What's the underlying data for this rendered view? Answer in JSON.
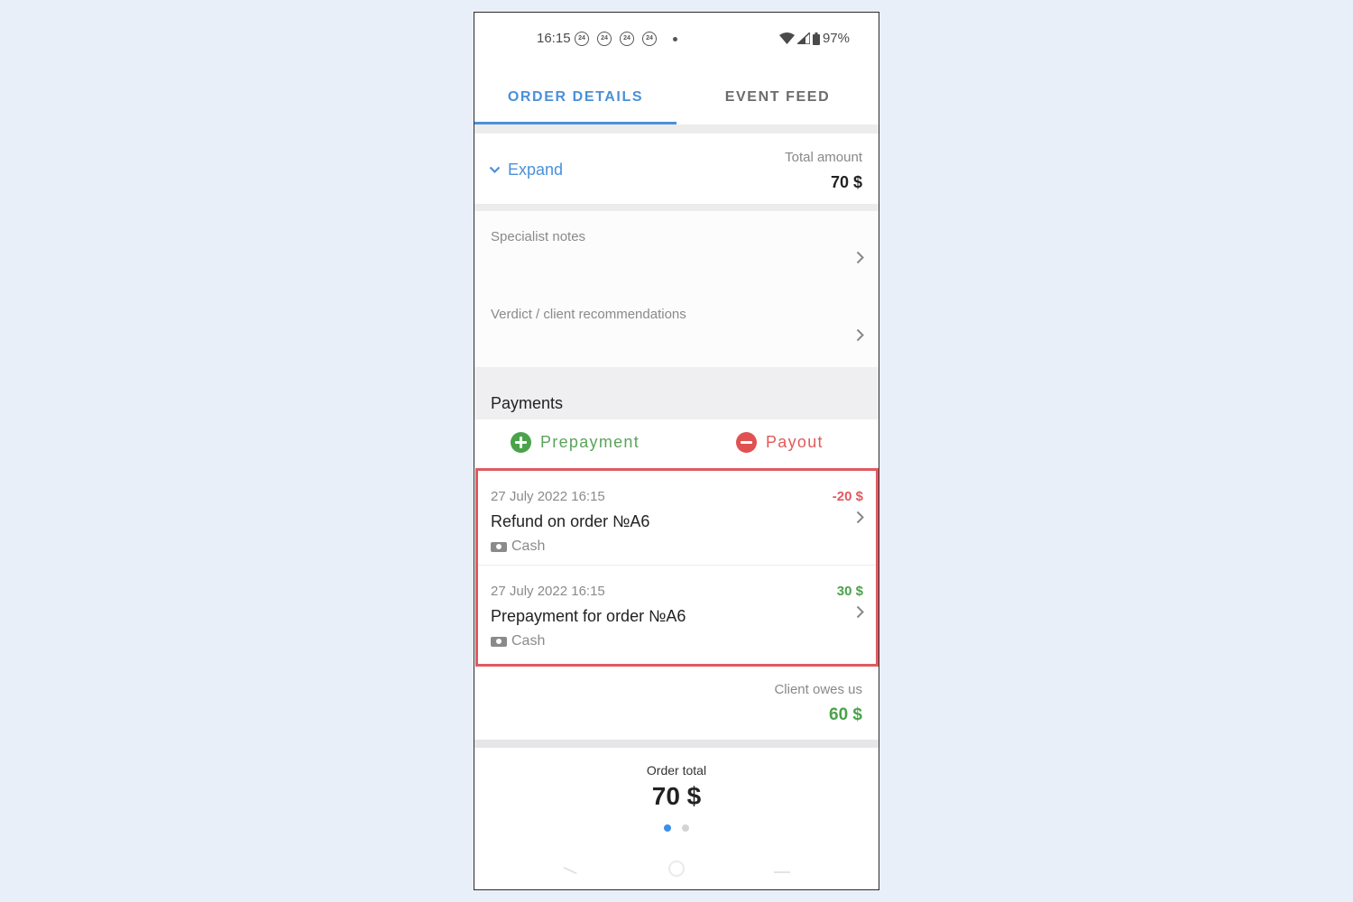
{
  "status_bar": {
    "time": "16:15",
    "notifications": [
      "24",
      "24",
      "24",
      "24"
    ],
    "battery": "97%",
    "icons": [
      "wifi-icon",
      "signal-icon",
      "battery-icon"
    ]
  },
  "tabs": [
    {
      "label": "ORDER DETAILS",
      "active": true
    },
    {
      "label": "EVENT FEED",
      "active": false
    }
  ],
  "summary": {
    "expand_label": "Expand",
    "total_label": "Total amount",
    "total_value": "70 $"
  },
  "sections": [
    {
      "label": "Specialist notes"
    },
    {
      "label": "Verdict / client recommendations"
    }
  ],
  "payments": {
    "title": "Payments",
    "prepayment_label": "Prepayment",
    "payout_label": "Payout",
    "transactions": [
      {
        "date": "27 July 2022 16:15",
        "amount": "-20 $",
        "type": "negative",
        "name": "Refund on order №A6",
        "method": "Cash"
      },
      {
        "date": "27 July 2022 16:15",
        "amount": "30 $",
        "type": "positive",
        "name": "Prepayment for order №A6",
        "method": "Cash"
      }
    ]
  },
  "balance": {
    "label": "Client owes us",
    "value": "60 $"
  },
  "order_total": {
    "label": "Order total",
    "value": "70 $",
    "page_indicator": {
      "current": 1,
      "total": 2
    }
  },
  "colors": {
    "accent": "#4a90d9",
    "positive": "#4aa34a",
    "negative": "#e05a5f",
    "highlight_border": "#e05a5f"
  }
}
